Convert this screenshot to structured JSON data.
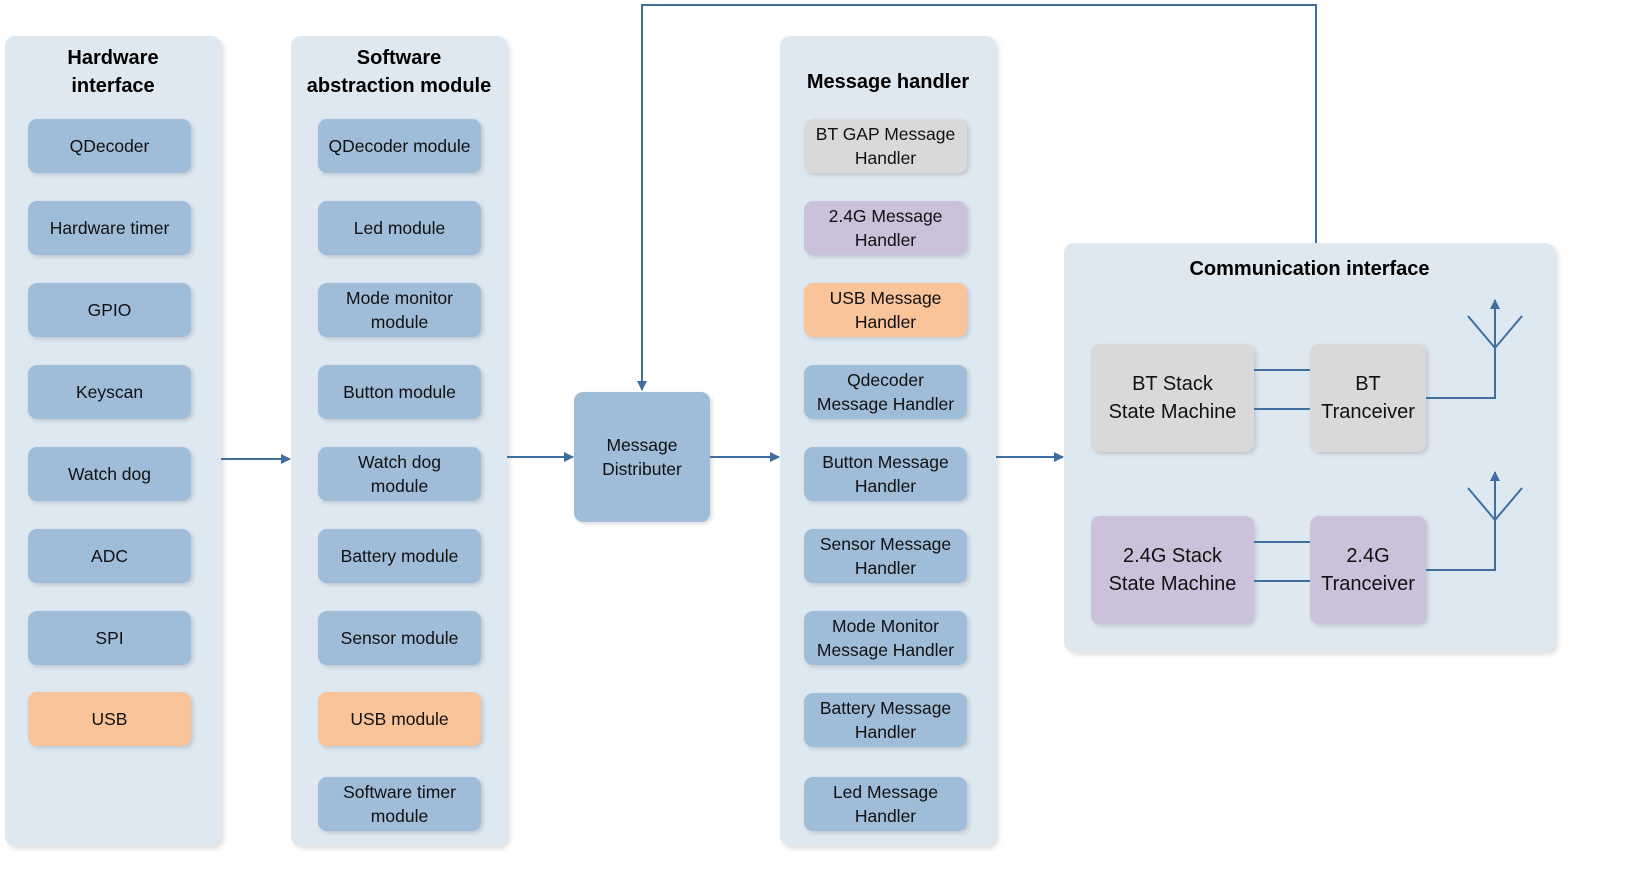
{
  "colors": {
    "panel": "#dee8f1",
    "module": "#9fbdd9",
    "usb": "#f9c49a",
    "bt": "#d9d9d9",
    "g24": "#ccc1da",
    "line": "#3f6f9f"
  },
  "hardware": {
    "title": "Hardware\ninterface",
    "items": [
      "QDecoder",
      "Hardware timer",
      "GPIO",
      "Keyscan",
      "Watch dog",
      "ADC",
      "SPI",
      "USB"
    ]
  },
  "software": {
    "title": "Software\nabstraction module",
    "items": [
      "QDecoder module",
      "Led module",
      "Mode monitor\nmodule",
      "Button module",
      "Watch dog\nmodule",
      "Battery module",
      "Sensor module",
      "USB module",
      "Software timer\nmodule"
    ]
  },
  "distributer": "Message\nDistributer",
  "handler": {
    "title": "Message handler",
    "items": [
      "BT GAP Message\nHandler",
      "2.4G Message\nHandler",
      "USB Message\nHandler",
      "Qdecoder\nMessage Handler",
      "Button Message\nHandler",
      "Sensor Message\nHandler",
      "Mode Monitor\nMessage Handler",
      "Battery Message\nHandler",
      "Led Message\nHandler"
    ]
  },
  "comm": {
    "title": "Communication interface",
    "bt_stack": "BT Stack\nState Machine",
    "bt_trx": "BT\nTranceiver",
    "g_stack": "2.4G Stack\nState Machine",
    "g_trx": "2.4G\nTranceiver"
  }
}
